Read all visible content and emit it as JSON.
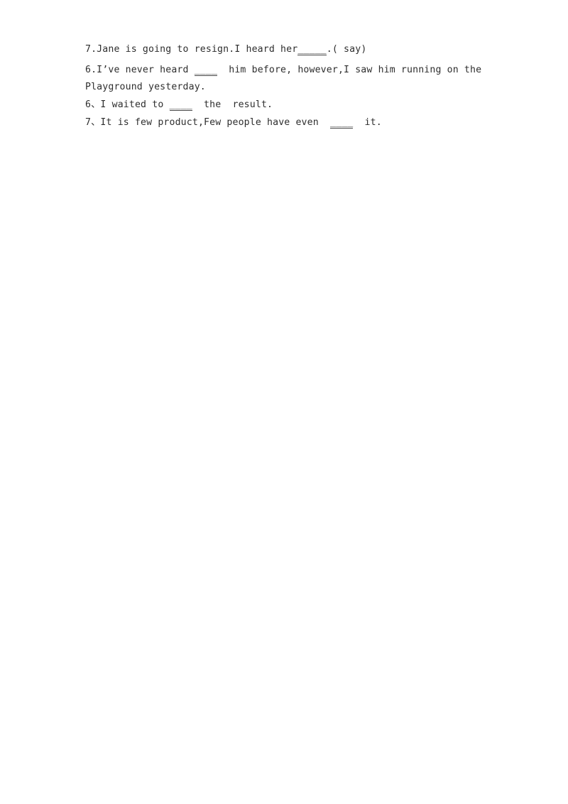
{
  "document": {
    "background_color": "#ffffff",
    "text_color": "#2e2e2e",
    "blank_rule_color": "#4a4a4a"
  },
  "exercises": [
    {
      "number_label": "7.",
      "separator": ".",
      "full_text": "7.Jane is going to resign.I heard her_____.( say)",
      "before_blank": "7.Jane is going to resign.I heard her",
      "blank": "_____",
      "after_blank": ".( say)",
      "hint": "( say)"
    },
    {
      "number_label": "6.",
      "separator": ".",
      "full_text": "6.I’ve never heard ____  him before, however,I saw him running on the Playground yesterday.",
      "before_blank": "6.I’ve never heard ",
      "blank": "____",
      "after_blank": "  him before, however,I saw him running on the ",
      "wrapped_line": "Playground yesterday.",
      "hint": ""
    },
    {
      "number_label": "6、",
      "separator": "、",
      "full_text": "6、I waited to ____  the  result.",
      "before_blank": "6、I waited to ",
      "blank": "____",
      "after_blank": "  the  result.",
      "hint": ""
    },
    {
      "number_label": "7、",
      "separator": "、",
      "full_text": "7、It is few product,Few people have even  ____  it.",
      "before_blank": "7、It is few product,Few people have even  ",
      "blank": "____",
      "after_blank": "  it.",
      "hint": ""
    }
  ]
}
